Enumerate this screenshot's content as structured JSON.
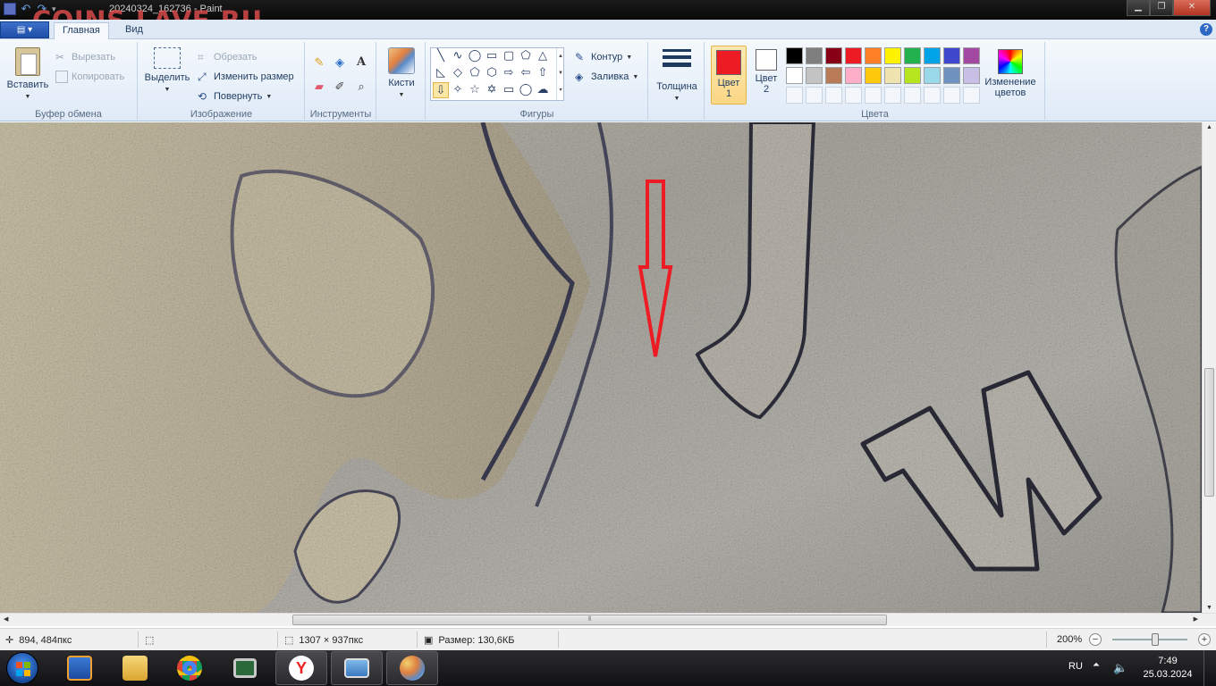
{
  "window": {
    "title": "20240324_162736 - Paint",
    "watermark": "COINS.LAVE.RU"
  },
  "tabs": {
    "app_menu": "▤ ▾",
    "home": "Главная",
    "view": "Вид",
    "help": "?"
  },
  "ribbon": {
    "clipboard": {
      "label": "Буфер обмена",
      "paste": "Вставить",
      "cut": "Вырезать",
      "copy": "Копировать"
    },
    "image": {
      "label": "Изображение",
      "select": "Выделить",
      "crop": "Обрезать",
      "resize": "Изменить размер",
      "rotate": "Повернуть"
    },
    "tools": {
      "label": "Инструменты"
    },
    "brushes": {
      "label": "Кисти"
    },
    "shapes": {
      "label": "Фигуры",
      "outline": "Контур",
      "fill": "Заливка"
    },
    "size": {
      "label": "Толщина"
    },
    "colors": {
      "label": "Цвета",
      "color1": "Цвет\n1",
      "color1_line1": "Цвет",
      "color1_line2": "1",
      "color2_line1": "Цвет",
      "color2_line2": "2",
      "edit": "Изменение цветов",
      "color1_value": "#ed1c24",
      "color2_value": "#ffffff",
      "palette": [
        "#000000",
        "#7f7f7f",
        "#880015",
        "#ed1c24",
        "#ff7f27",
        "#fff200",
        "#22b14c",
        "#00a2e8",
        "#3f48cc",
        "#a349a4",
        "#ffffff",
        "#c3c3c3",
        "#b97a57",
        "#ffaec9",
        "#ffc90e",
        "#efe4b0",
        "#b5e61d",
        "#99d9ea",
        "#7092be",
        "#c8bfe7"
      ]
    }
  },
  "status": {
    "cursor": "894, 484пкс",
    "selection": "",
    "dimensions": "1307 × 937пкс",
    "filesize": "Размер: 130,6КБ",
    "zoom": "200%"
  },
  "taskbar": {
    "language": "RU",
    "time": "7:49",
    "date": "25.03.2024"
  }
}
